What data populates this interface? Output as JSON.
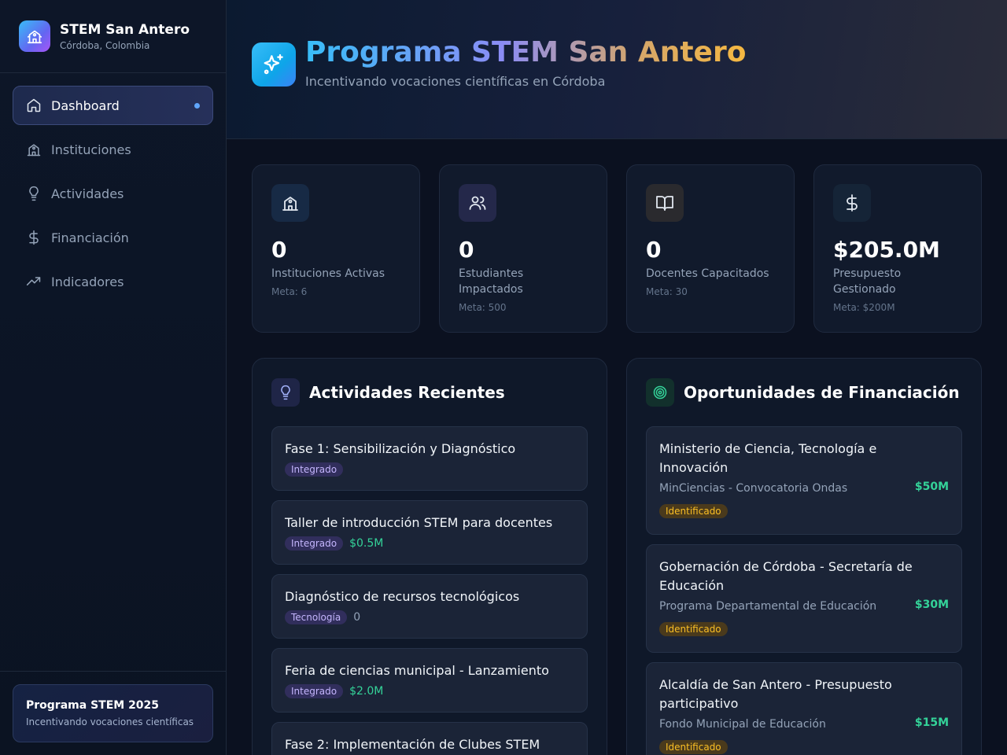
{
  "brand": {
    "title": "STEM San Antero",
    "subtitle": "Córdoba, Colombia"
  },
  "nav": {
    "items": [
      {
        "label": "Dashboard",
        "icon": "home-icon",
        "active": true
      },
      {
        "label": "Instituciones",
        "icon": "school-icon"
      },
      {
        "label": "Actividades",
        "icon": "lightbulb-icon"
      },
      {
        "label": "Financiación",
        "icon": "dollar-icon"
      },
      {
        "label": "Indicadores",
        "icon": "trending-up-icon"
      }
    ]
  },
  "promo": {
    "title": "Programa STEM 2025",
    "subtitle": "Incentivando vocaciones científicas"
  },
  "header": {
    "title": "Programa STEM San Antero",
    "subtitle": "Incentivando vocaciones científicas en Córdoba",
    "icon": "sparkles-icon"
  },
  "stats": [
    {
      "value": "0",
      "label": "Instituciones Activas",
      "meta": "Meta: 6",
      "icon": "school-icon",
      "color": "#38bdf8"
    },
    {
      "value": "0",
      "label": "Estudiantes Impactados",
      "meta": "Meta: 500",
      "icon": "users-icon",
      "color": "#a78bfa"
    },
    {
      "value": "0",
      "label": "Docentes Capacitados",
      "meta": "Meta: 30",
      "icon": "book-icon",
      "color": "#f1f5f9"
    },
    {
      "value": "$205.0M",
      "label": "Presupuesto Gestionado",
      "meta": "Meta: $200M",
      "icon": "dollar-icon",
      "color": "#f1f5f9"
    }
  ],
  "activities": {
    "title": "Actividades Recientes",
    "items": [
      {
        "title": "Fase 1: Sensibilización y Diagnóstico",
        "tag": "Integrado",
        "amount": ""
      },
      {
        "title": "Taller de introducción STEM para docentes",
        "tag": "Integrado",
        "amount": "$0.5M"
      },
      {
        "title": "Diagnóstico de recursos tecnológicos",
        "tag": "Tecnología",
        "amount": "0"
      },
      {
        "title": "Feria de ciencias municipal - Lanzamiento",
        "tag": "Integrado",
        "amount": "$2.0M"
      },
      {
        "title": "Fase 2: Implementación de Clubes STEM",
        "tag": "",
        "amount": ""
      }
    ]
  },
  "funding": {
    "title": "Oportunidades de Financiación",
    "items": [
      {
        "title": "Ministerio de Ciencia, Tecnología e Innovación",
        "source": "MinCiencias - Convocatoria Ondas",
        "amount": "$50M",
        "status": "Identificado"
      },
      {
        "title": "Gobernación de Córdoba - Secretaría de Educación",
        "source": "Programa Departamental de Educación",
        "amount": "$30M",
        "status": "Identificado"
      },
      {
        "title": "Alcaldía de San Antero - Presupuesto participativo",
        "source": "Fondo Municipal de Educación",
        "amount": "$15M",
        "status": "Identificado"
      }
    ]
  }
}
